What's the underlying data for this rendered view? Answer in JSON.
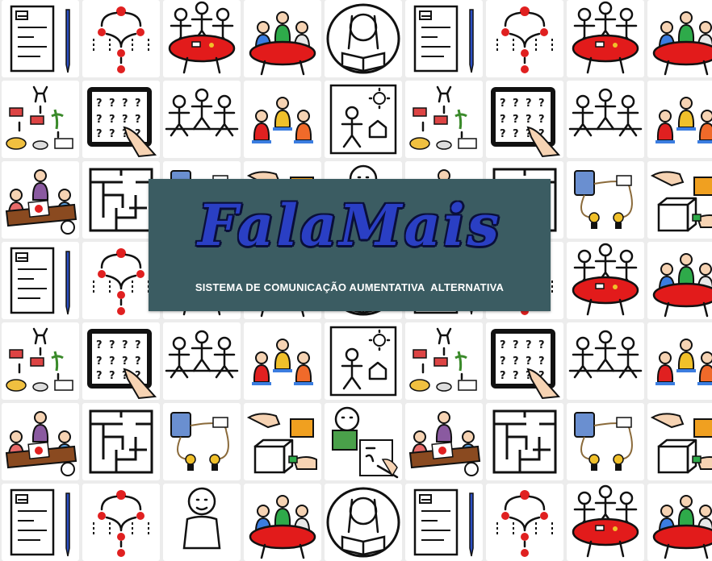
{
  "colors": {
    "background": "#ececec",
    "banner": "#3b5c62",
    "logo": "#2a3fc4"
  },
  "banner": {
    "logo_text": "FalaMais",
    "subtitle": "SISTEMA DE COMUNICAÇÃO AUMENTATIVA  ALTERNATIVA"
  },
  "pictogram_grid": {
    "rows": [
      [
        "form-pen-icon",
        "hierarchy-icon",
        "meeting-table-icon",
        "group-work-icon",
        "reading-child-icon",
        "form-pen-icon",
        "hierarchy-icon",
        "meeting-table-icon",
        "group-work-icon"
      ],
      [
        "food-chain-icon",
        "tablet-quiz-icon",
        "stick-figures-icon",
        "kids-sitting-icon",
        "drawing-icon",
        "food-chain-icon",
        "tablet-quiz-icon",
        "stick-figures-icon",
        "kids-sitting-icon"
      ],
      [
        "teacher-desk-icon",
        "maze-icon",
        "circuit-icon",
        "hands-box-icon",
        "face-icon",
        "teacher-desk-icon",
        "maze-icon",
        "circuit-icon",
        "hands-box-icon"
      ],
      [
        "form-pen-icon",
        "hierarchy-icon",
        "meeting-table-icon",
        "group-work-icon",
        "reading-child-icon",
        "form-pen-icon",
        "hierarchy-icon",
        "meeting-table-icon",
        "group-work-icon"
      ],
      [
        "food-chain-icon",
        "tablet-quiz-icon",
        "stick-figures-icon",
        "kids-sitting-icon",
        "drawing-icon",
        "food-chain-icon",
        "tablet-quiz-icon",
        "stick-figures-icon",
        "kids-sitting-icon"
      ],
      [
        "teacher-desk-icon",
        "maze-icon",
        "circuit-icon",
        "hands-box-icon",
        "reading-writing-icon",
        "teacher-desk-icon",
        "maze-icon",
        "circuit-icon",
        "hands-box-icon"
      ],
      [
        "form-pen-icon",
        "hierarchy-icon",
        "face-icon",
        "group-work-icon",
        "reading-child-icon",
        "form-pen-icon",
        "hierarchy-icon",
        "meeting-table-icon",
        "group-work-icon"
      ]
    ]
  }
}
